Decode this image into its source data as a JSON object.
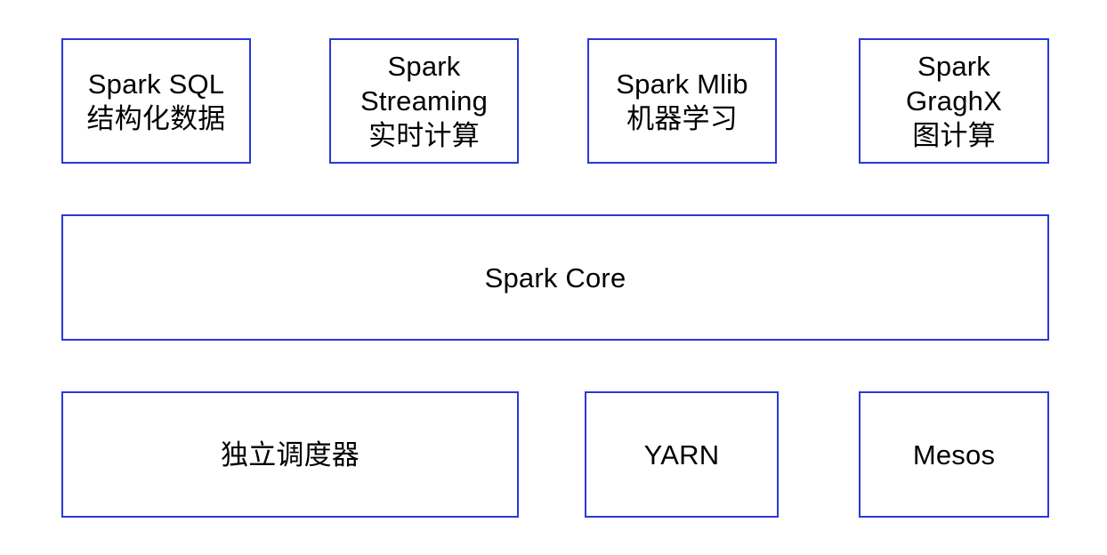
{
  "components": {
    "sql": {
      "line1": "Spark SQL",
      "line2": "结构化数据"
    },
    "streaming": {
      "line1": "Spark",
      "line2": "Streaming",
      "line3": "实时计算"
    },
    "mllib": {
      "line1": "Spark Mlib",
      "line2": "机器学习"
    },
    "graphx": {
      "line1": "Spark",
      "line2": "GraghX",
      "line3": "图计算"
    }
  },
  "core": {
    "label": "Spark Core"
  },
  "cluster_managers": {
    "standalone": "独立调度器",
    "yarn": "YARN",
    "mesos": "Mesos"
  },
  "colors": {
    "border": "#2a38d8",
    "background": "#ffffff",
    "text": "#000000"
  }
}
